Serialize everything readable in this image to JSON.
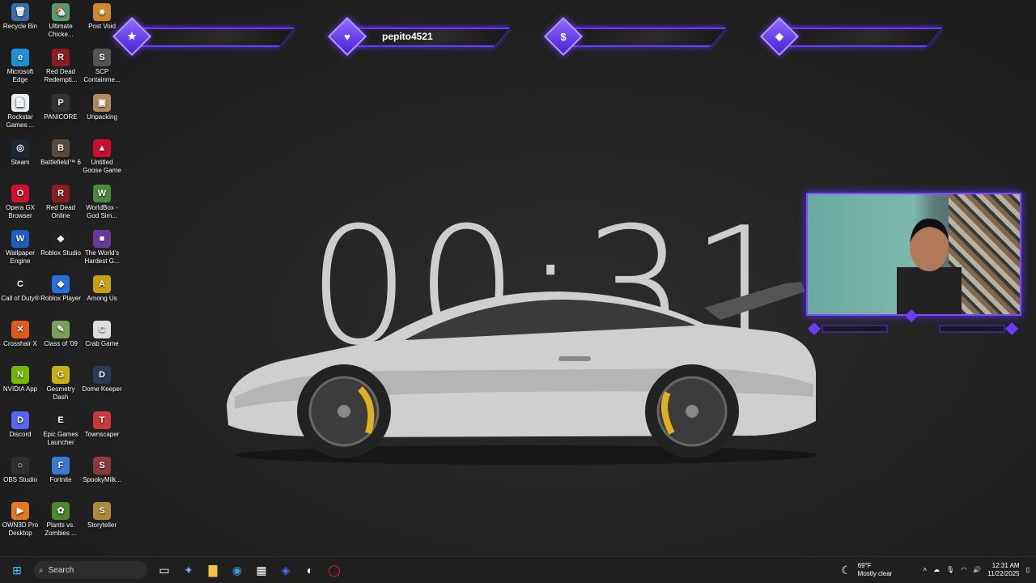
{
  "desktop_icons": [
    {
      "label": "Recycle Bin",
      "glyph": "🗑",
      "color": "#3a6ea5"
    },
    {
      "label": "Ultimate Chicke...",
      "glyph": "🐔",
      "color": "#5a9a6a"
    },
    {
      "label": "Post Void",
      "glyph": "☻",
      "color": "#d08a2a"
    },
    {
      "label": "Microsoft Edge",
      "glyph": "e",
      "color": "#1f8fd6"
    },
    {
      "label": "Red Dead Redempti...",
      "glyph": "R",
      "color": "#8a1e1e"
    },
    {
      "label": "SCP Containme...",
      "glyph": "S",
      "color": "#555"
    },
    {
      "label": "Rockstar Games ...",
      "glyph": "📄",
      "color": "#eeeeee"
    },
    {
      "label": "PANICORE",
      "glyph": "P",
      "color": "#333"
    },
    {
      "label": "Unpacking",
      "glyph": "▣",
      "color": "#b08a5a"
    },
    {
      "label": "Steam",
      "glyph": "◎",
      "color": "#1b2838"
    },
    {
      "label": "Battlefield™ 6",
      "glyph": "B",
      "color": "#5a4a3a"
    },
    {
      "label": "Untitled Goose Game",
      "glyph": "▲",
      "color": "#c8102e"
    },
    {
      "label": "Opera GX Browser",
      "glyph": "O",
      "color": "#d1122e"
    },
    {
      "label": "Red Dead Online",
      "glyph": "R",
      "color": "#8a1e1e"
    },
    {
      "label": "WorldBox - God Sim...",
      "glyph": "W",
      "color": "#4a8a3a"
    },
    {
      "label": "Wallpaper Engine",
      "glyph": "W",
      "color": "#1a5fbf"
    },
    {
      "label": "Roblox Studio",
      "glyph": "◆",
      "color": "#222"
    },
    {
      "label": "The World's Hardest G...",
      "glyph": "■",
      "color": "#6a3a9a"
    },
    {
      "label": "Call of Duty®",
      "glyph": "C",
      "color": "#222"
    },
    {
      "label": "Roblox Player",
      "glyph": "◆",
      "color": "#2a6fe0"
    },
    {
      "label": "Among Us",
      "glyph": "A",
      "color": "#c8a010"
    },
    {
      "label": "Crosshair X",
      "glyph": "✕",
      "color": "#e05a1a"
    },
    {
      "label": "Class of '09",
      "glyph": "✎",
      "color": "#7aa05a"
    },
    {
      "label": "Crab Game",
      "glyph": "C",
      "color": "#dddddd"
    },
    {
      "label": "NVIDIA App",
      "glyph": "N",
      "color": "#76b900"
    },
    {
      "label": "Geometry Dash",
      "glyph": "G",
      "color": "#c8b010"
    },
    {
      "label": "Dome Keeper",
      "glyph": "D",
      "color": "#2a3a5a"
    },
    {
      "label": "Discord",
      "glyph": "D",
      "color": "#5865f2"
    },
    {
      "label": "Epic Games Launcher",
      "glyph": "E",
      "color": "#222"
    },
    {
      "label": "Townscaper",
      "glyph": "T",
      "color": "#c83a3a"
    },
    {
      "label": "OBS Studio",
      "glyph": "○",
      "color": "#302e31"
    },
    {
      "label": "Fortnite",
      "glyph": "F",
      "color": "#3a7ad0"
    },
    {
      "label": "SpookyMilk...",
      "glyph": "S",
      "color": "#8a3a3a"
    },
    {
      "label": "OWN3D Pro Desktop",
      "glyph": "▶",
      "color": "#e07a1a"
    },
    {
      "label": "Plants vs. Zombies ...",
      "glyph": "✿",
      "color": "#4a8a2a"
    },
    {
      "label": "Storyteller",
      "glyph": "S",
      "color": "#b08a3a"
    }
  ],
  "overlay": {
    "bars": [
      {
        "icon": "★",
        "text": ""
      },
      {
        "icon": "♥",
        "text": "pepito4521"
      },
      {
        "icon": "$",
        "text": ""
      },
      {
        "icon": "◆",
        "text": ""
      }
    ],
    "accent": "#6b3cff"
  },
  "timer": {
    "value": "00:31"
  },
  "taskbar": {
    "search_label": "Search",
    "weather_temp": "69°F",
    "weather_desc": "Mostly clear",
    "time": "12:31 AM",
    "date": "11/22/2025"
  }
}
